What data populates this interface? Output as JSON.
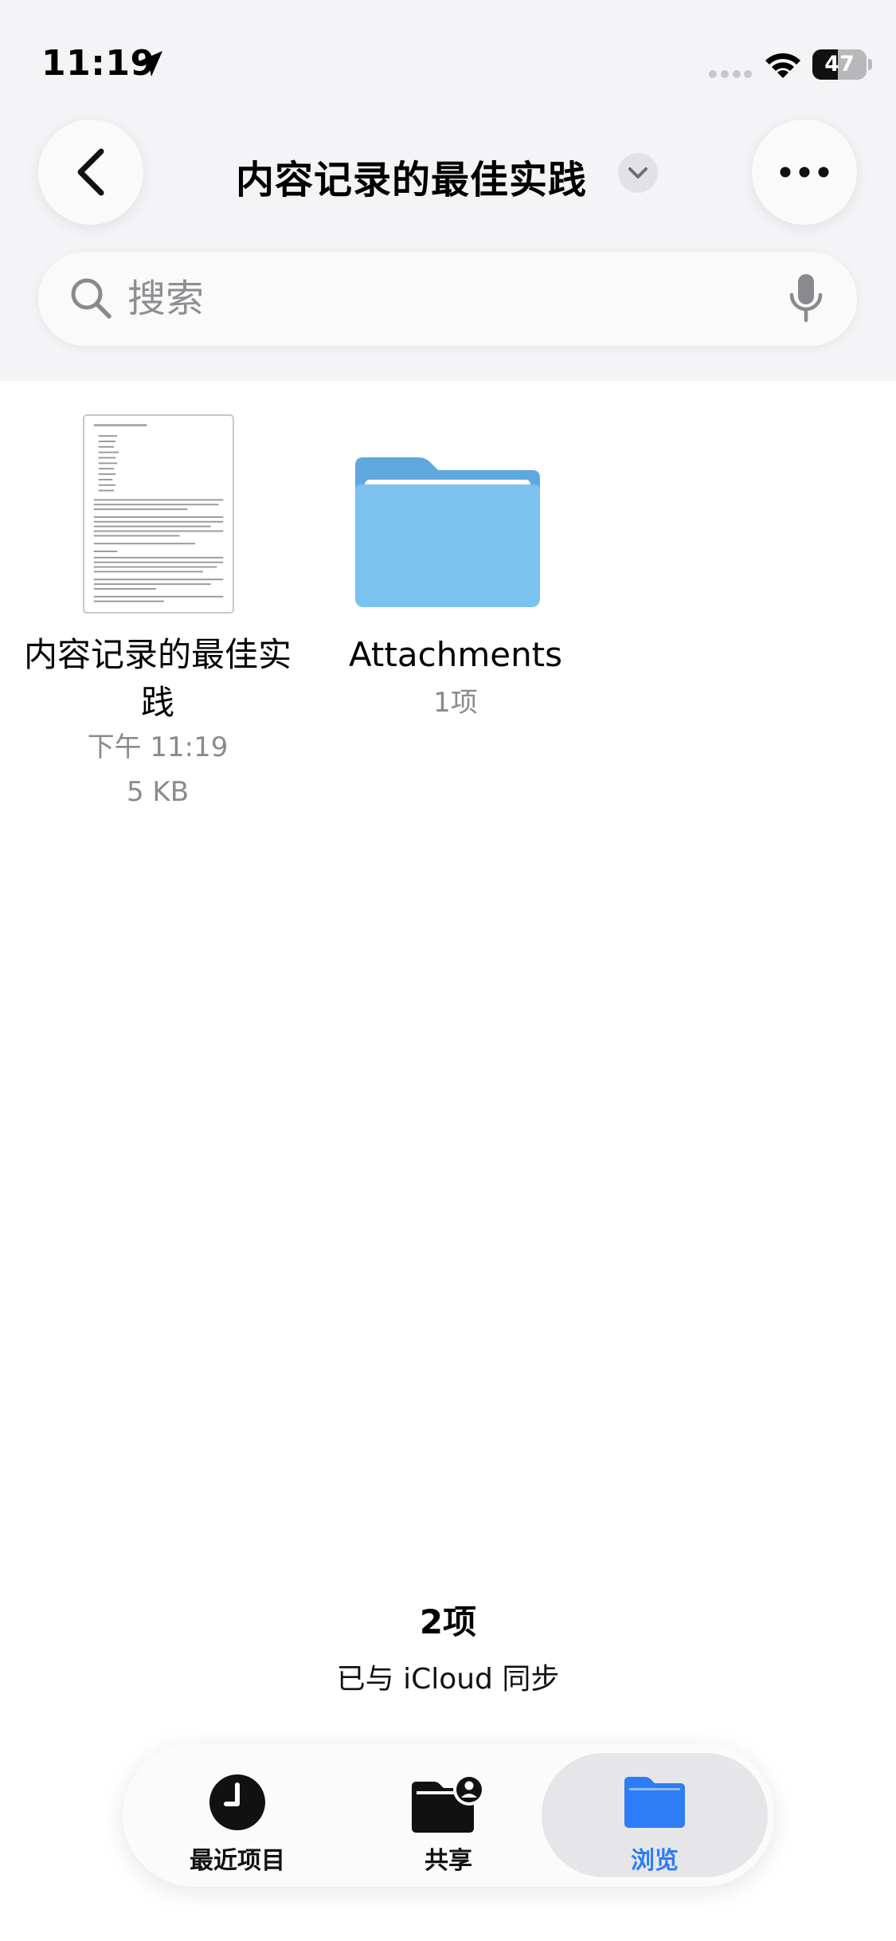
{
  "status_bar": {
    "time": "11:19",
    "battery_level": "47",
    "icons": [
      "location-arrow-icon",
      "cellular-signal-icon",
      "wifi-icon",
      "battery-icon"
    ]
  },
  "nav": {
    "title": "内容记录的最佳实践",
    "icons": [
      "back-chevron-icon",
      "chevron-down-icon",
      "more-icon"
    ]
  },
  "search": {
    "placeholder": "搜索",
    "icons": [
      "search-icon",
      "microphone-icon"
    ]
  },
  "items": [
    {
      "name": "内容记录的最佳实践",
      "time": "下午 11:19",
      "size": "5 KB",
      "icon": "document-thumbnail"
    },
    {
      "name": "Attachments",
      "count": "1项",
      "icon": "folder-icon"
    }
  ],
  "summary": {
    "count": "2项",
    "sync": "已与 iCloud 同步"
  },
  "tabs": [
    {
      "label": "最近项目",
      "icon": "clock-icon",
      "selected": false
    },
    {
      "label": "共享",
      "icon": "shared-folder-icon",
      "selected": false
    },
    {
      "label": "浏览",
      "icon": "folder-icon",
      "selected": true
    }
  ],
  "colors": {
    "accent": "#2e7cf6",
    "folder": "#6bb6ea",
    "secondary_text": "#8a8a8e",
    "header_background": "#f4f4f6"
  }
}
